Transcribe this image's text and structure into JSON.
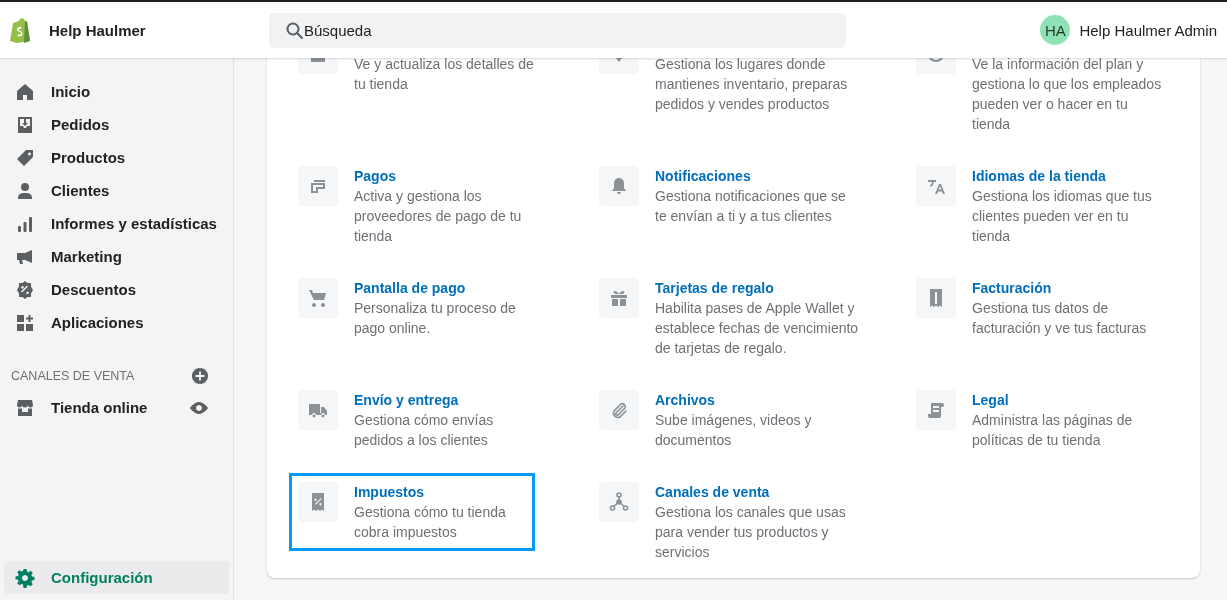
{
  "header": {
    "store_name": "Help Haulmer",
    "search": {
      "placeholder": "Búsqueda"
    },
    "user": {
      "initials": "HA",
      "name": "Help Haulmer Admin"
    }
  },
  "sidebar": {
    "items": [
      {
        "label": "Inicio",
        "selected": false
      },
      {
        "label": "Pedidos",
        "selected": false
      },
      {
        "label": "Productos",
        "selected": false
      },
      {
        "label": "Clientes",
        "selected": false
      },
      {
        "label": "Informes y estadísticas",
        "selected": false
      },
      {
        "label": "Marketing",
        "selected": false
      },
      {
        "label": "Descuentos",
        "selected": false
      },
      {
        "label": "Aplicaciones",
        "selected": false
      }
    ],
    "sales_channels": {
      "heading": "CANALES DE VENTA",
      "items": [
        {
          "label": "Tienda online",
          "selected": false
        }
      ]
    },
    "settings_item": {
      "label": "Configuración",
      "selected": true
    }
  },
  "settings": [
    {
      "description": "Ve y actualiza los detalles de\ntu tienda",
      "highlighted": false
    },
    {
      "description": "Gestiona los lugares donde\nmantienes inventario, preparas\npedidos y vendes productos",
      "highlighted": false
    },
    {
      "description": "Ve la información del plan y\ngestiona lo que los empleados\npueden ver o hacer en tu\ntienda",
      "highlighted": false
    },
    {
      "title": "Pagos",
      "description": "Activa y gestiona los\nproveedores de pago de tu\ntienda",
      "highlighted": false
    },
    {
      "title": "Notificaciones",
      "description": "Gestiona notificaciones que se\nte envían a ti y a tus clientes",
      "highlighted": false
    },
    {
      "title": "Idiomas de la tienda",
      "description": "Gestiona los idiomas que tus\nclientes pueden ver en tu\ntienda",
      "highlighted": false
    },
    {
      "title": "Pantalla de pago",
      "description": "Personaliza tu proceso de\npago online.",
      "highlighted": false
    },
    {
      "title": "Tarjetas de regalo",
      "description": "Habilita pases de Apple Wallet y\nestablece fechas de vencimiento\nde tarjetas de regalo.",
      "highlighted": false
    },
    {
      "title": "Facturación",
      "description": "Gestiona tus datos de\nfacturación y ve tus facturas",
      "highlighted": false
    },
    {
      "title": "Envío y entrega",
      "description": "Gestiona cómo envías\npedidos a los clientes",
      "highlighted": false
    },
    {
      "title": "Archivos",
      "description": "Sube imágenes, videos y\ndocumentos",
      "highlighted": false
    },
    {
      "title": "Legal",
      "description": "Administra las páginas de\npolíticas de tu tienda",
      "highlighted": false
    },
    {
      "title": "Impuestos",
      "description": "Gestiona cómo tu tienda\ncobra impuestos",
      "highlighted": true
    },
    {
      "title": "Canales de venta",
      "description": "Gestiona los canales que usas\npara vender tus productos y\nservicios",
      "highlighted": false
    }
  ]
}
